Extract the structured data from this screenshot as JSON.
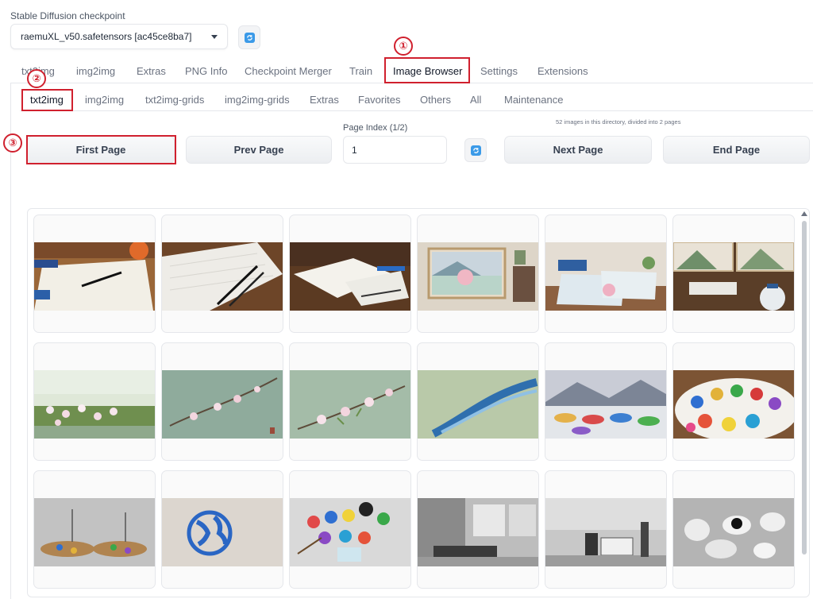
{
  "checkpoint": {
    "label": "Stable Diffusion checkpoint",
    "value": "raemuXL_v50.safetensors [ac45ce8ba7]"
  },
  "tabs": [
    "txt2img",
    "img2img",
    "Extras",
    "PNG Info",
    "Checkpoint Merger",
    "Train",
    "Image Browser",
    "Settings",
    "Extensions"
  ],
  "active_tab": "Image Browser",
  "subtabs": [
    "txt2img",
    "img2img",
    "txt2img-grids",
    "img2img-grids",
    "Extras",
    "Favorites",
    "Others",
    "All",
    "Maintenance"
  ],
  "active_subtab": "txt2img",
  "info_text": "52 images in this directory, divided into 2 pages",
  "page_index": {
    "label": "Page Index (1/2)",
    "value": "1"
  },
  "buttons": {
    "first": "First Page",
    "prev": "Prev Page",
    "next": "Next Page",
    "end": "End Page"
  },
  "annotations": [
    "①",
    "②",
    "③"
  ],
  "colors": {
    "accent": "#3b9ae8",
    "annotation_red": "#d0202e"
  },
  "thumbnails": [
    "desk with paper, pens and orange",
    "sheet of paper with two pens",
    "papers and blue pen on desk",
    "framed landscape painting with pink blossoms",
    "watercolor lotus paintings on desk",
    "framed mountain lake paintings with vase",
    "green meadow with white blossoms",
    "pink blossom branch on green background",
    "blossom branch on pale green",
    "blue ink wave on green",
    "paint palettes near lake and mountains",
    "paint palette with many colors",
    "two paint palettes with brushes",
    "blue world map circle",
    "color paint pans and brushes",
    "monochrome interior room",
    "monochrome modern interior",
    "white cups and saucers"
  ]
}
